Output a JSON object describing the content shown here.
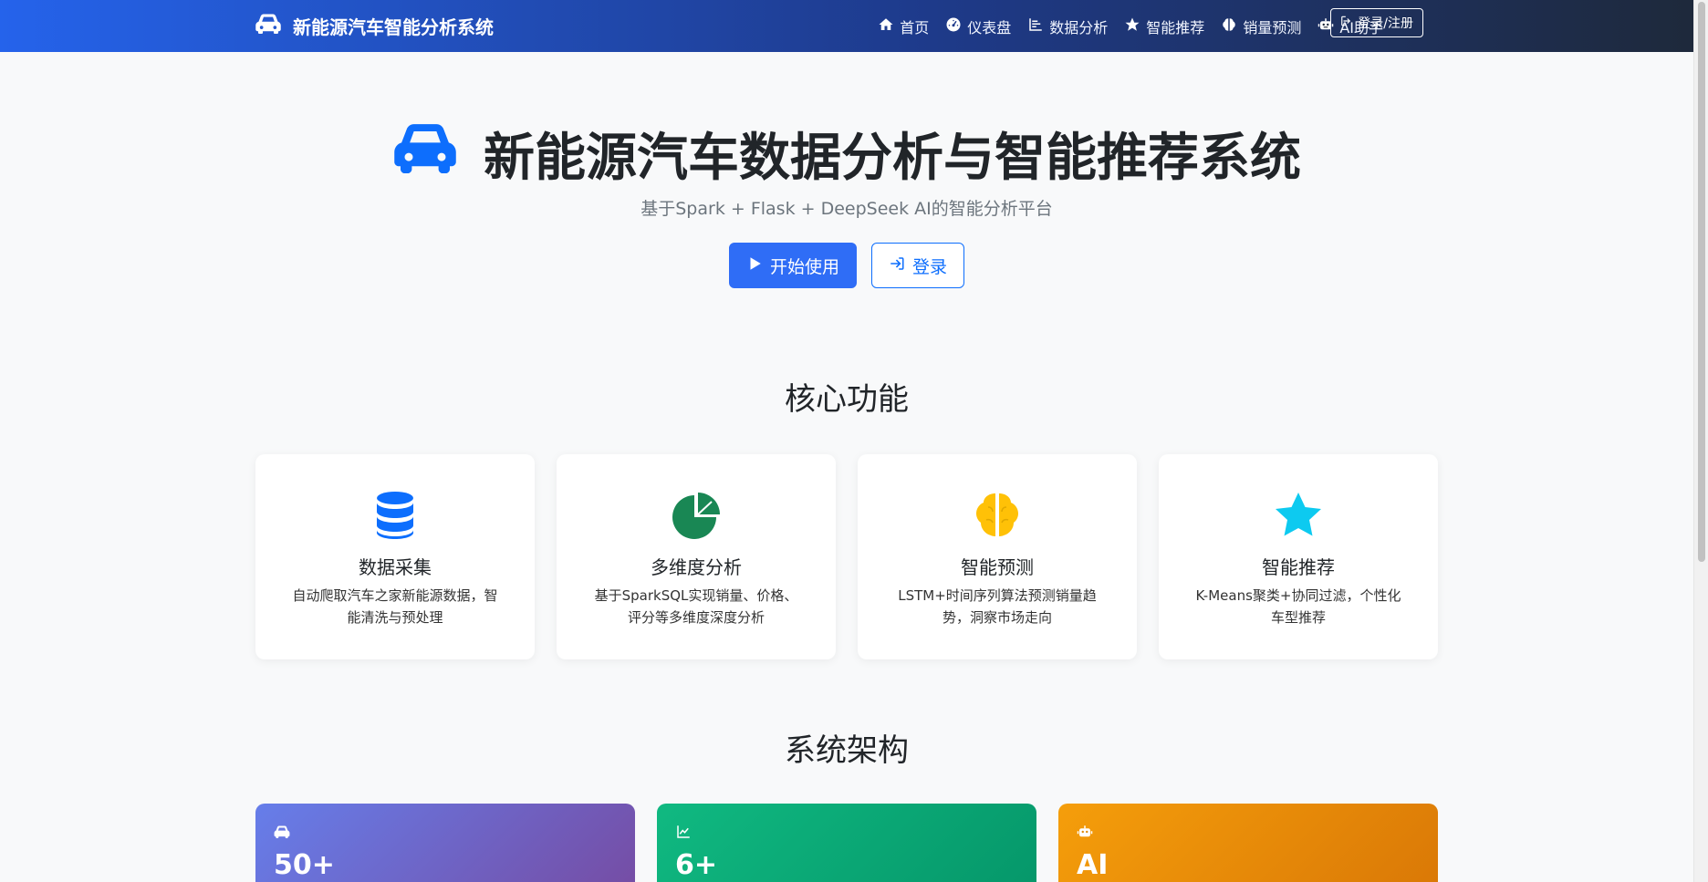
{
  "nav": {
    "brand": "新能源汽车智能分析系统",
    "items": [
      {
        "label": "首页",
        "icon": "home-icon"
      },
      {
        "label": "仪表盘",
        "icon": "dashboard-icon"
      },
      {
        "label": "数据分析",
        "icon": "chart-icon"
      },
      {
        "label": "智能推荐",
        "icon": "star-icon"
      },
      {
        "label": "销量预测",
        "icon": "brain-icon"
      },
      {
        "label": "AI助手",
        "icon": "robot-icon"
      }
    ],
    "login": "登录/注册"
  },
  "hero": {
    "title": "新能源汽车数据分析与智能推荐系统",
    "subtitle": "基于Spark + Flask + DeepSeek AI的智能分析平台",
    "start_button": "开始使用",
    "login_button": "登录"
  },
  "features": {
    "heading": "核心功能",
    "cards": [
      {
        "title": "数据采集",
        "desc": "自动爬取汽车之家新能源数据，智能清洗与预处理",
        "icon": "database-icon",
        "color": "#0d6efd"
      },
      {
        "title": "多维度分析",
        "desc": "基于SparkSQL实现销量、价格、评分等多维度深度分析",
        "icon": "pie-chart-icon",
        "color": "#198754"
      },
      {
        "title": "智能预测",
        "desc": "LSTM+时间序列算法预测销量趋势，洞察市场走向",
        "icon": "brain-icon",
        "color": "#ffc107"
      },
      {
        "title": "智能推荐",
        "desc": "K-Means聚类+协同过滤，个性化车型推荐",
        "icon": "star-icon",
        "color": "#0dcaf0"
      }
    ]
  },
  "architecture": {
    "heading": "系统架构",
    "cards": [
      {
        "value": "50+",
        "icon": "car-icon"
      },
      {
        "value": "6+",
        "icon": "line-chart-icon"
      },
      {
        "value": "AI",
        "icon": "robot-icon"
      }
    ]
  }
}
